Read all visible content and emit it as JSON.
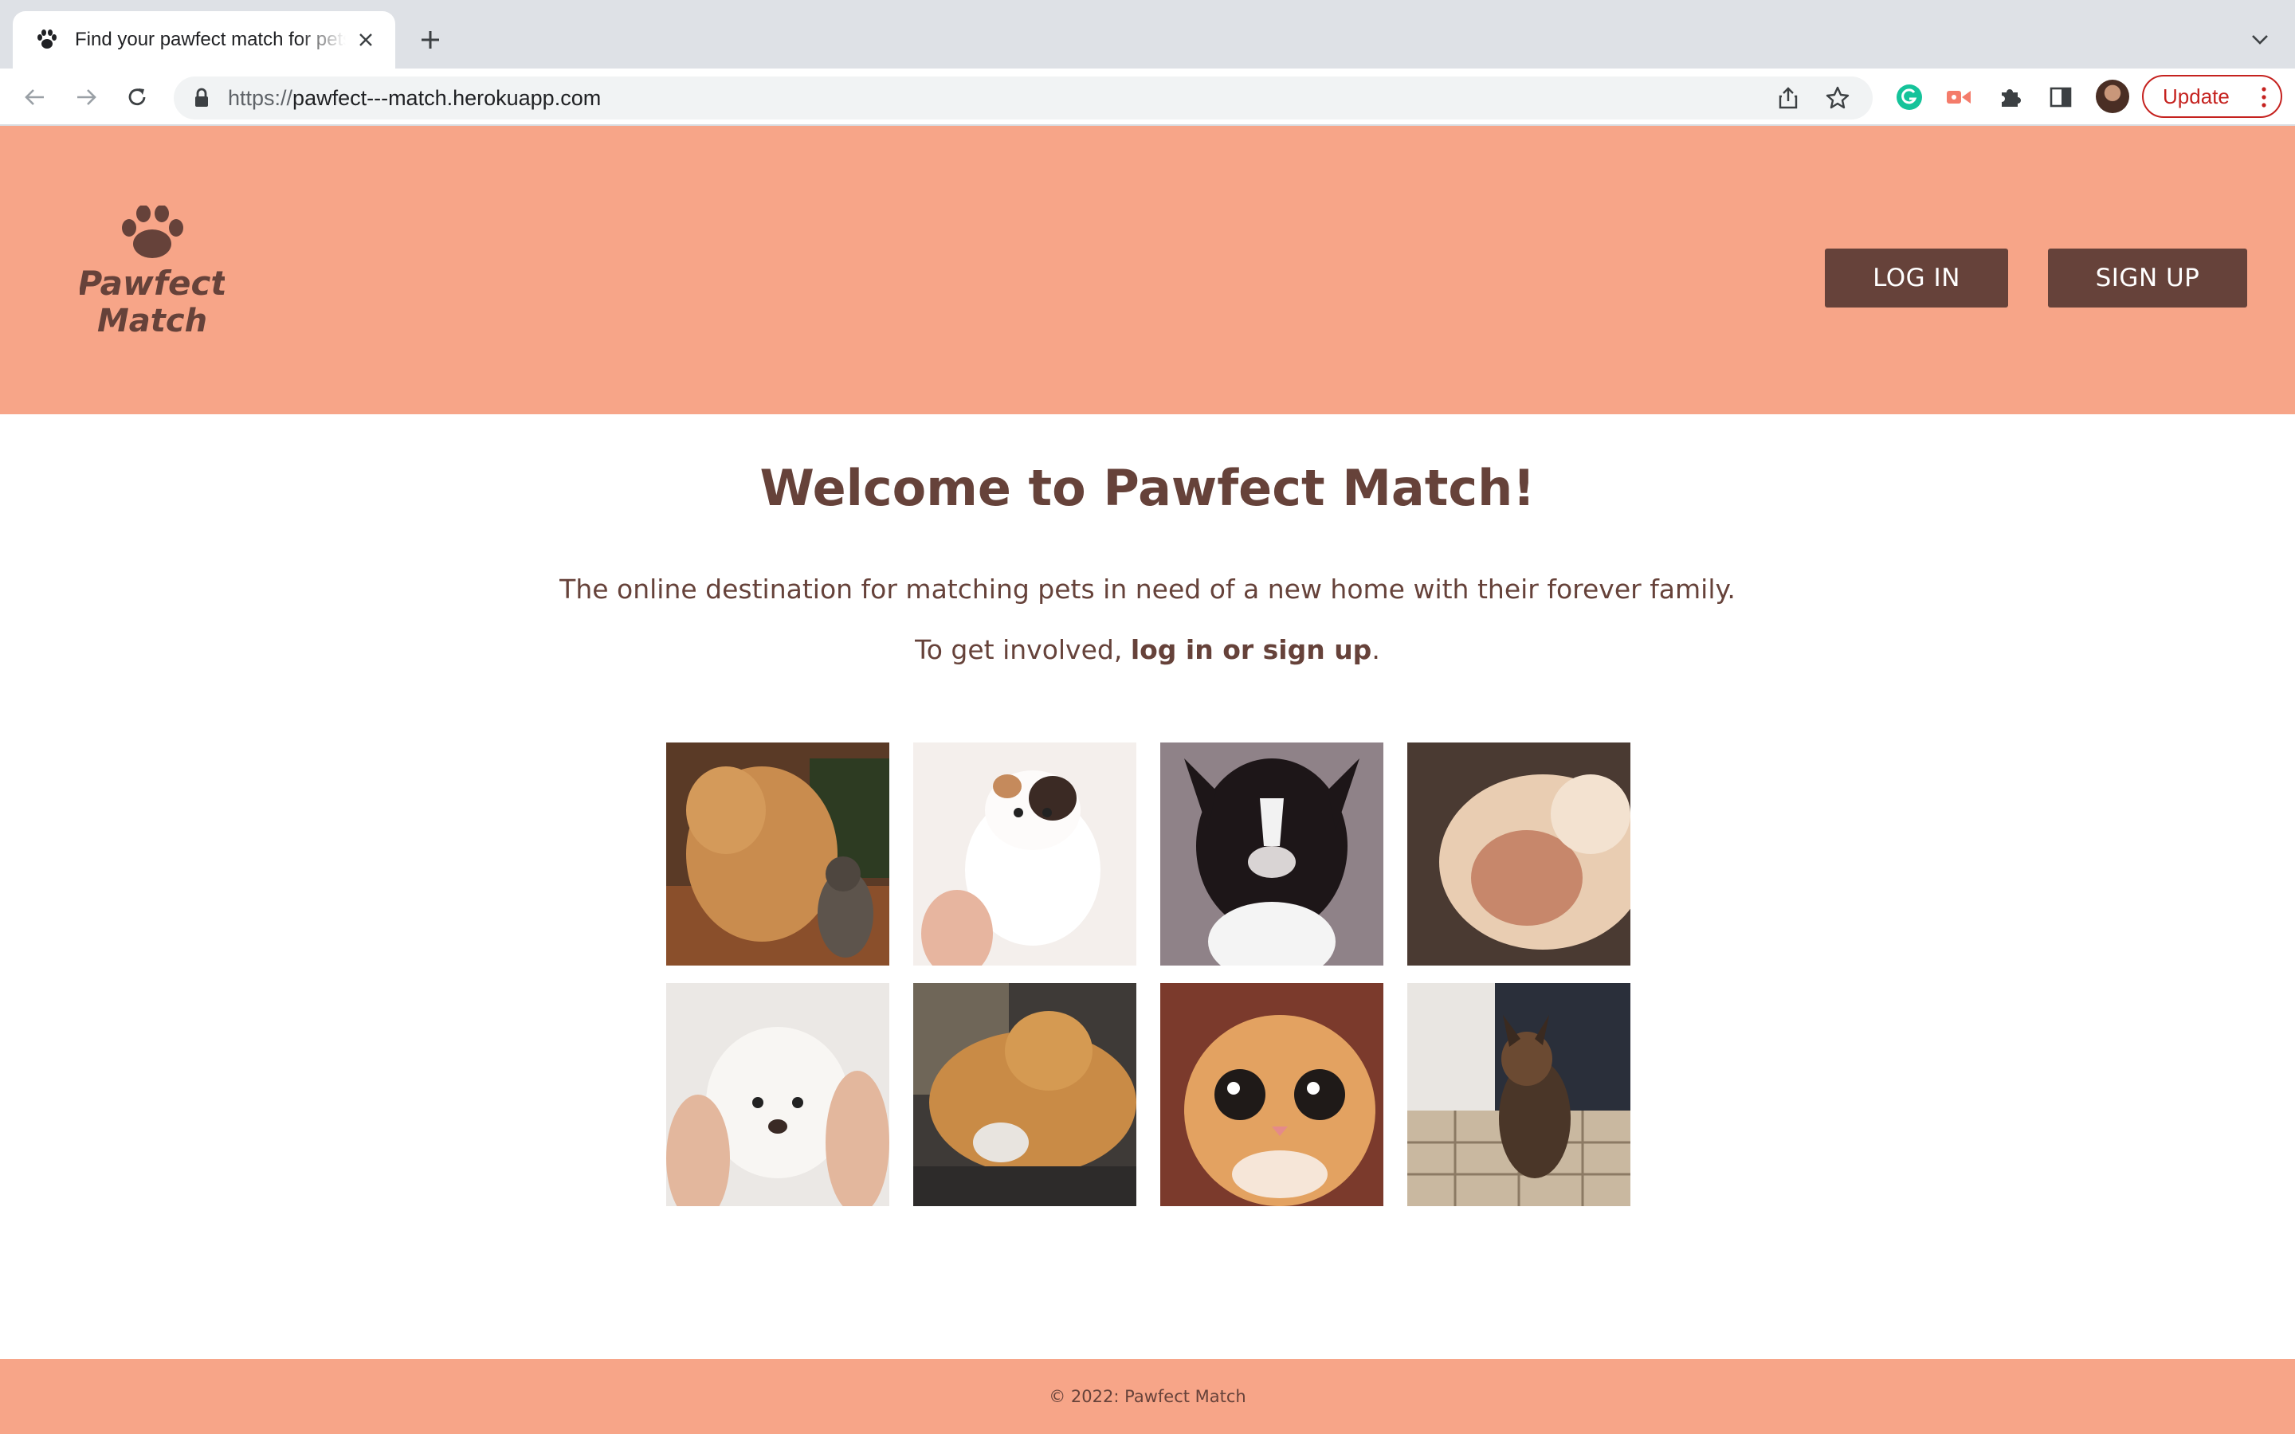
{
  "browser": {
    "tab_title": "Find your pawfect match for pets",
    "url_scheme": "https://",
    "url_host": "pawfect---match.herokuapp.com",
    "update_label": "Update"
  },
  "header": {
    "logo_text_line1": "Pawfect",
    "logo_text_line2": "Match",
    "login_label": "LOG IN",
    "signup_label": "SIGN UP"
  },
  "main": {
    "heading": "Welcome to Pawfect Match!",
    "tagline": "The online destination for matching pets in need of a new home with their forever family.",
    "involve_prefix": "To get involved, ",
    "involve_link": "log in or sign up",
    "involve_suffix": "."
  },
  "gallery": [
    {
      "name": "golden-retriever-with-kitten-gif"
    },
    {
      "name": "calico-kitten-gif"
    },
    {
      "name": "black-white-dog-gif"
    },
    {
      "name": "blurry-cat-gif"
    },
    {
      "name": "white-puppy-gif"
    },
    {
      "name": "golden-retriever-lying-gif"
    },
    {
      "name": "orange-cat-closeup-gif"
    },
    {
      "name": "german-shepherd-puppy-gif"
    }
  ],
  "footer": {
    "copyright": "© 2022: Pawfect Match"
  },
  "colors": {
    "brand_salmon": "#f7a588",
    "brand_brown": "#66423a"
  }
}
